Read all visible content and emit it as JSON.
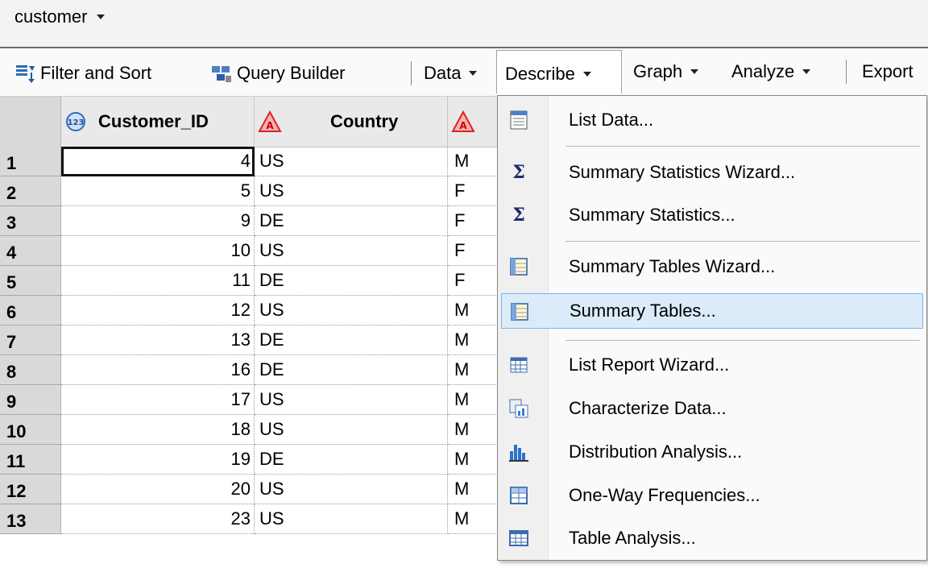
{
  "tab": {
    "label": "customer"
  },
  "toolbar": {
    "filter_sort": "Filter and Sort",
    "query_builder": "Query Builder",
    "data": "Data",
    "describe": "Describe",
    "graph": "Graph",
    "analyze": "Analyze",
    "export": "Export"
  },
  "columns": {
    "id": "Customer_ID",
    "country": "Country"
  },
  "rows": [
    {
      "n": "1",
      "id": "4",
      "country": "US",
      "g": "M"
    },
    {
      "n": "2",
      "id": "5",
      "country": "US",
      "g": "F"
    },
    {
      "n": "3",
      "id": "9",
      "country": "DE",
      "g": "F"
    },
    {
      "n": "4",
      "id": "10",
      "country": "US",
      "g": "F"
    },
    {
      "n": "5",
      "id": "11",
      "country": "DE",
      "g": "F"
    },
    {
      "n": "6",
      "id": "12",
      "country": "US",
      "g": "M"
    },
    {
      "n": "7",
      "id": "13",
      "country": "DE",
      "g": "M"
    },
    {
      "n": "8",
      "id": "16",
      "country": "DE",
      "g": "M"
    },
    {
      "n": "9",
      "id": "17",
      "country": "US",
      "g": "M"
    },
    {
      "n": "10",
      "id": "18",
      "country": "US",
      "g": "M"
    },
    {
      "n": "11",
      "id": "19",
      "country": "DE",
      "g": "M"
    },
    {
      "n": "12",
      "id": "20",
      "country": "US",
      "g": "M"
    },
    {
      "n": "13",
      "id": "23",
      "country": "US",
      "g": "M"
    }
  ],
  "menu": {
    "items": [
      {
        "label": "List Data...",
        "icon": "list-data-icon"
      },
      {
        "label": "Summary Statistics Wizard...",
        "icon": "sigma-icon"
      },
      {
        "label": "Summary Statistics...",
        "icon": "sigma-icon"
      },
      {
        "label": "Summary Tables Wizard...",
        "icon": "summary-table-icon"
      },
      {
        "label": "Summary Tables...",
        "icon": "summary-table-icon",
        "highlighted": true
      },
      {
        "label": "List Report Wizard...",
        "icon": "list-report-icon"
      },
      {
        "label": "Characterize Data...",
        "icon": "characterize-icon"
      },
      {
        "label": "Distribution Analysis...",
        "icon": "histogram-icon"
      },
      {
        "label": "One-Way Frequencies...",
        "icon": "frequency-icon"
      },
      {
        "label": "Table Analysis...",
        "icon": "table-analysis-icon"
      }
    ]
  },
  "colors": {
    "highlight_bg": "#dcebfa",
    "highlight_border": "#7fb3e6",
    "rownum_bg": "#d9d9d9"
  }
}
